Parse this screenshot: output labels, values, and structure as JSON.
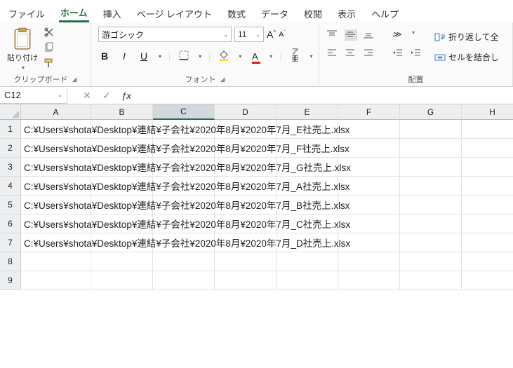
{
  "menu": {
    "items": [
      "ファイル",
      "ホーム",
      "挿入",
      "ページ レイアウト",
      "数式",
      "データ",
      "校閲",
      "表示",
      "ヘルプ"
    ],
    "active_index": 1
  },
  "ribbon": {
    "clipboard": {
      "paste": "貼り付け",
      "group_label": "クリップボード"
    },
    "font": {
      "name": "游ゴシック",
      "size": "11",
      "bold": "B",
      "italic": "I",
      "underline": "U",
      "ruby": "ア亜",
      "group_label": "フォント"
    },
    "alignment": {
      "wrap": "折り返して全",
      "merge": "セルを結合し",
      "group_label": "配置"
    }
  },
  "namebox": {
    "value": "C12"
  },
  "formula": {
    "value": ""
  },
  "columns": [
    "A",
    "B",
    "C",
    "D",
    "E",
    "F",
    "G",
    "H"
  ],
  "rows": [
    "1",
    "2",
    "3",
    "4",
    "5",
    "6",
    "7",
    "8",
    "9"
  ],
  "selected_column_index": 2,
  "selected_row_index_display": 11,
  "cells": {
    "A1": "C:¥Users¥shota¥Desktop¥連結¥子会社¥2020年8月¥2020年7月_E社売上.xlsx",
    "A2": "C:¥Users¥shota¥Desktop¥連結¥子会社¥2020年8月¥2020年7月_F社売上.xlsx",
    "A3": "C:¥Users¥shota¥Desktop¥連結¥子会社¥2020年8月¥2020年7月_G社売上.xlsx",
    "A4": "C:¥Users¥shota¥Desktop¥連結¥子会社¥2020年8月¥2020年7月_A社売上.xlsx",
    "A5": "C:¥Users¥shota¥Desktop¥連結¥子会社¥2020年8月¥2020年7月_B社売上.xlsx",
    "A6": "C:¥Users¥shota¥Desktop¥連結¥子会社¥2020年8月¥2020年7月_C社売上.xlsx",
    "A7": "C:¥Users¥shota¥Desktop¥連結¥子会社¥2020年8月¥2020年7月_D社売上.xlsx"
  }
}
